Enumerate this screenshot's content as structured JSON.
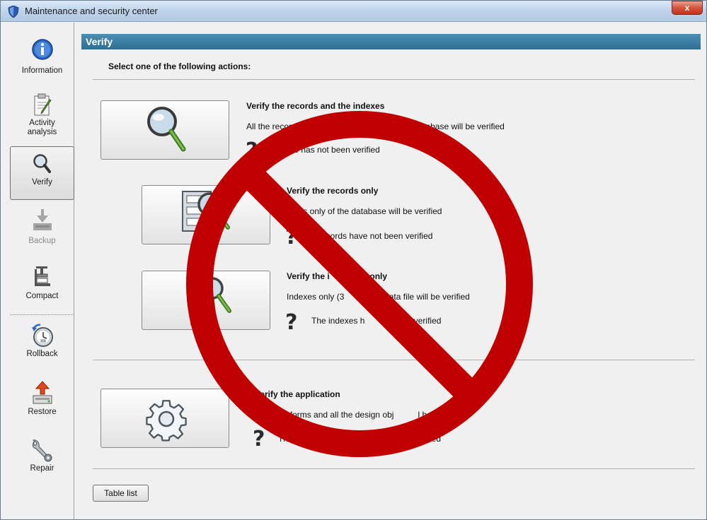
{
  "window": {
    "title": "Maintenance and security center",
    "close_label": "x"
  },
  "sidebar": {
    "items": [
      {
        "label": "Information",
        "icon": "info-icon",
        "state": "normal"
      },
      {
        "label": "Activity analysis",
        "line1": "Activity",
        "line2": "analysis",
        "icon": "clipboard-icon",
        "state": "normal"
      },
      {
        "label": "Verify",
        "icon": "magnifier-icon",
        "state": "active"
      },
      {
        "label": "Backup",
        "icon": "backup-icon",
        "state": "disabled"
      },
      {
        "label": "Compact",
        "icon": "compact-icon",
        "state": "normal"
      },
      {
        "label": "Rollback",
        "icon": "rollback-clock-icon",
        "state": "normal"
      },
      {
        "label": "Restore",
        "icon": "restore-icon",
        "state": "normal"
      },
      {
        "label": "Repair",
        "icon": "wrench-icon",
        "state": "normal"
      }
    ]
  },
  "main": {
    "header": "Verify",
    "instruction": "Select one of the following actions:",
    "actions": [
      {
        "title": "Verify the records and the indexes",
        "desc_part1": "All the records an",
        "desc_part2": "(7) of the database will be verified",
        "status": "data file has not been verified",
        "icon": "magnifier-icon"
      },
      {
        "title": "Verify the records only",
        "desc": "cords only of the database will be verified",
        "status": "e records have not been verified",
        "icon": "records-magnifier-icon"
      },
      {
        "title_part1": "Verify the i",
        "title_part2": "es only",
        "desc_part1": "Indexes only (3",
        "desc_part2": "f the data file will be verified",
        "status_part1": "The indexes h",
        "status_part2": "ot been verified",
        "icon": "indexes-magnifier-icon"
      },
      {
        "title": "Verify the application",
        "desc_part1": "ethods, forms and all the design obj",
        "desc_part2": "l be verified",
        "status_part1": "The",
        "status_part2": "fied",
        "icon": "gear-icon"
      }
    ],
    "table_list_button": "Table list"
  },
  "overlay": {
    "icon": "prohibition-sign-icon",
    "color": "#c00000"
  }
}
